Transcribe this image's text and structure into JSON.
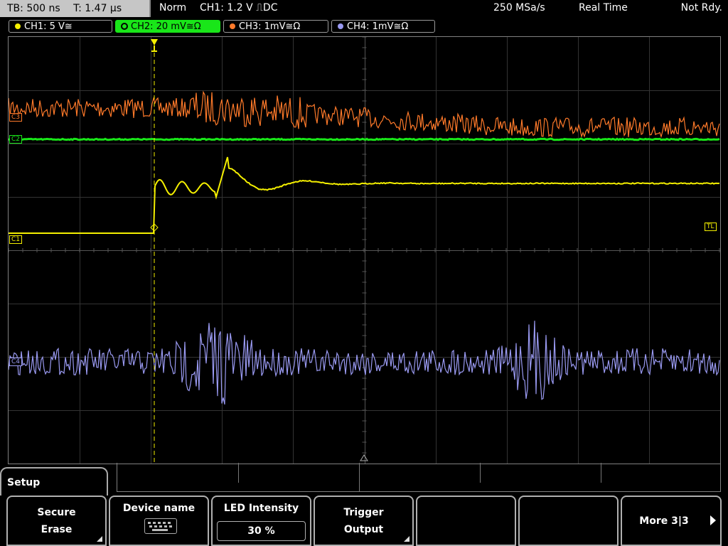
{
  "status_bar": {
    "timebase": "TB: 500 ns",
    "trigger_time": "T: 1.47 µs",
    "trigger_mode": "Norm",
    "trigger_source": "CH1: 1.2 V ⎍DC",
    "sample_rate": "250 MSa/s",
    "acquisition": "Real Time",
    "state": "Not Rdy."
  },
  "channels": [
    {
      "label": "CH1: 5 V≅",
      "color": "#f5f000"
    },
    {
      "label": "CH2: 20 mV≅Ω",
      "color": "#19e619",
      "active": true
    },
    {
      "label": "CH3: 1mV≅Ω",
      "color": "#ff7a2a"
    },
    {
      "label": "CH4: 1mV≅Ω",
      "color": "#9a9af2"
    }
  ],
  "markers": {
    "c3": "C3",
    "c2": "C2",
    "c1": "C1",
    "c4": "C4",
    "trigger_level": "TL"
  },
  "menu": {
    "title": "Setup",
    "softkeys": {
      "secure_erase": {
        "line1": "Secure",
        "line2": "Erase"
      },
      "device_name": {
        "label": "Device name"
      },
      "led_intensity": {
        "label": "LED Intensity",
        "value": "30 %"
      },
      "trigger_output": {
        "line1": "Trigger",
        "line2": "Output"
      },
      "more": {
        "label": "More 3|3"
      }
    }
  },
  "icons": {
    "keyboard": "keyboard-icon",
    "submenu": "submenu-corner-icon",
    "next": "next-page-arrow-icon",
    "trigger": "trigger-position-icon"
  }
}
